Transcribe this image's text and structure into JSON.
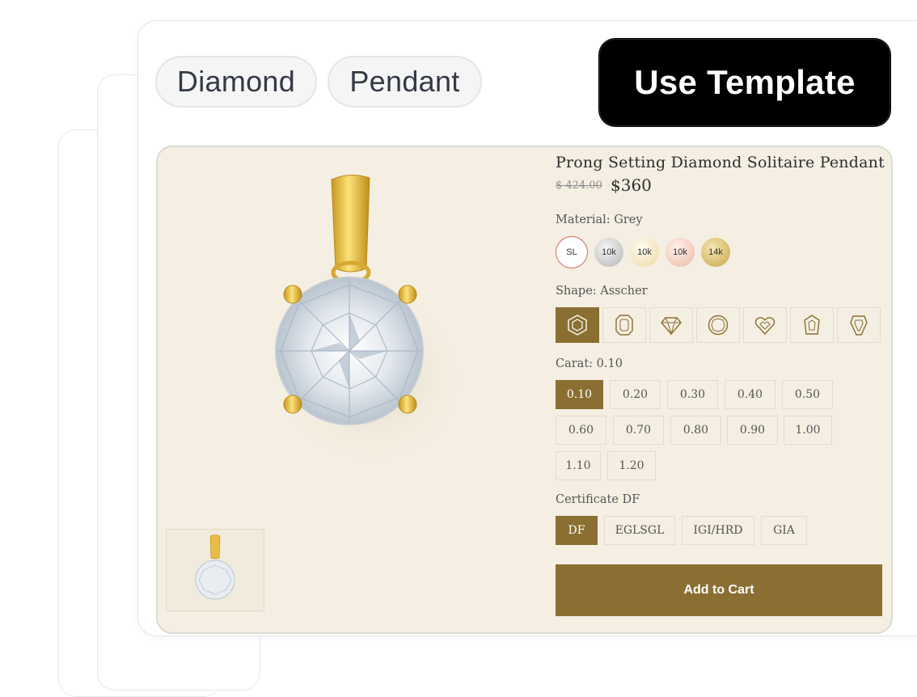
{
  "tags": [
    "Diamond",
    "Pendant"
  ],
  "use_template_label": "Use Template",
  "product": {
    "title": "Prong Setting Diamond Solitaire Pendant",
    "old_price": "$ 424.00",
    "price": "$360",
    "material_label": "Material: Grey",
    "materials": [
      "SL",
      "10k",
      "10k",
      "10k",
      "14k"
    ],
    "shape_label": "Shape: Asscher",
    "shapes": [
      "asscher-icon",
      "emerald-icon",
      "trillion-icon",
      "round-icon",
      "heart-icon",
      "pear-icon",
      "kite-icon"
    ],
    "carat_label": "Carat: 0.10",
    "carats": [
      "0.10",
      "0.20",
      "0.30",
      "0.40",
      "0.50",
      "0.60",
      "0.70",
      "0.80",
      "0.90",
      "1.00",
      "1.10",
      "1.20"
    ],
    "selected_carat": "0.10",
    "certificate_label": "Certificate DF",
    "certificates": [
      "DF",
      "EGLSGL",
      "IGI/HRD",
      "GIA"
    ],
    "selected_certificate": "DF",
    "add_to_cart_label": "Add to Cart"
  },
  "colors": {
    "accent": "#8b6e31",
    "preview_bg": "#f4efe2",
    "button_black": "#000000"
  }
}
